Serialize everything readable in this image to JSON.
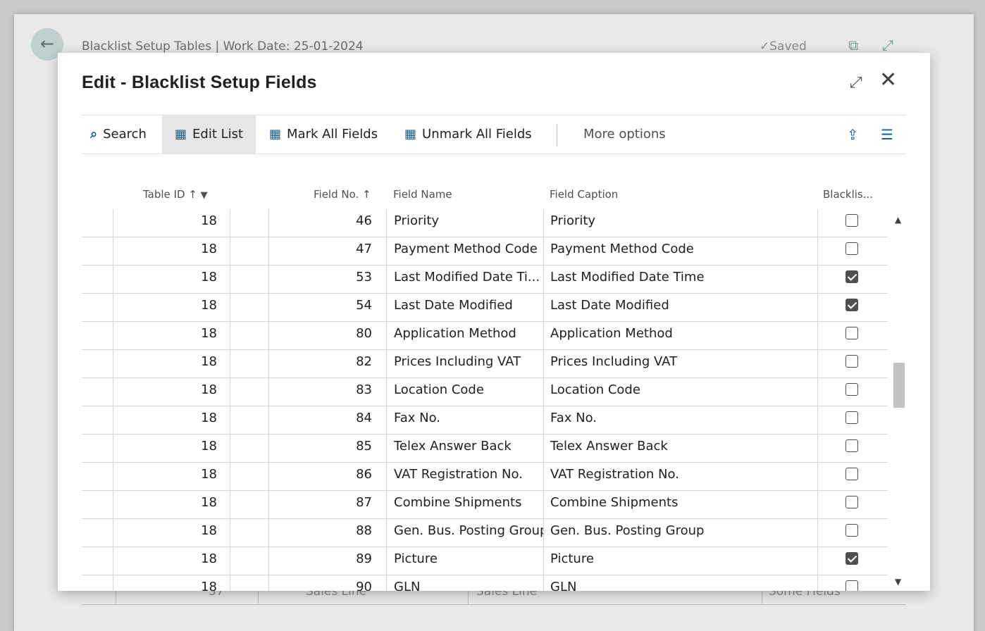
{
  "background": {
    "title": "Blacklist Setup Tables | Work Date: 25-01-2024",
    "saved": "Saved",
    "partial_row": [
      "37",
      "Sales Line",
      "Sales Line",
      "Some Fields"
    ]
  },
  "dialog": {
    "title": "Edit - Blacklist Setup Fields",
    "toolbar": {
      "search": "Search",
      "edit_list": "Edit List",
      "mark_all": "Mark All Fields",
      "unmark_all": "Unmark All Fields",
      "more": "More options"
    },
    "columns": {
      "table_id": "Table ID ↑",
      "field_no": "Field No. ↑",
      "field_name": "Field Name",
      "field_caption": "Field Caption",
      "blacklisted": "Blacklis..."
    },
    "rows": [
      {
        "table_id": "18",
        "field_no": "46",
        "field_name": "Priority",
        "field_caption": "Priority",
        "blacklisted": false
      },
      {
        "table_id": "18",
        "field_no": "47",
        "field_name": "Payment Method Code",
        "field_caption": "Payment Method Code",
        "blacklisted": false
      },
      {
        "table_id": "18",
        "field_no": "53",
        "field_name": "Last Modified Date Ti...",
        "field_caption": "Last Modified Date Time",
        "blacklisted": true
      },
      {
        "table_id": "18",
        "field_no": "54",
        "field_name": "Last Date Modified",
        "field_caption": "Last Date Modified",
        "blacklisted": true
      },
      {
        "table_id": "18",
        "field_no": "80",
        "field_name": "Application Method",
        "field_caption": "Application Method",
        "blacklisted": false
      },
      {
        "table_id": "18",
        "field_no": "82",
        "field_name": "Prices Including VAT",
        "field_caption": "Prices Including VAT",
        "blacklisted": false
      },
      {
        "table_id": "18",
        "field_no": "83",
        "field_name": "Location Code",
        "field_caption": "Location Code",
        "blacklisted": false
      },
      {
        "table_id": "18",
        "field_no": "84",
        "field_name": "Fax No.",
        "field_caption": "Fax No.",
        "blacklisted": false
      },
      {
        "table_id": "18",
        "field_no": "85",
        "field_name": "Telex Answer Back",
        "field_caption": "Telex Answer Back",
        "blacklisted": false
      },
      {
        "table_id": "18",
        "field_no": "86",
        "field_name": "VAT Registration No.",
        "field_caption": "VAT Registration No.",
        "blacklisted": false
      },
      {
        "table_id": "18",
        "field_no": "87",
        "field_name": "Combine Shipments",
        "field_caption": "Combine Shipments",
        "blacklisted": false
      },
      {
        "table_id": "18",
        "field_no": "88",
        "field_name": "Gen. Bus. Posting Group",
        "field_caption": "Gen. Bus. Posting Group",
        "blacklisted": false
      },
      {
        "table_id": "18",
        "field_no": "89",
        "field_name": "Picture",
        "field_caption": "Picture",
        "blacklisted": true
      },
      {
        "table_id": "18",
        "field_no": "90",
        "field_name": "GLN",
        "field_caption": "GLN",
        "blacklisted": false
      }
    ]
  },
  "icons": {
    "back": "arrow-left-icon",
    "saved": "check-icon",
    "open_new": "open-in-new-window-icon",
    "expand": "expand-icon",
    "close": "close-icon",
    "search": "search-icon",
    "edit_list": "edit-list-icon",
    "mark_all": "mark-all-icon",
    "unmark_all": "unmark-all-icon",
    "share": "share-icon",
    "list_view": "list-view-icon",
    "filter": "filter-icon"
  }
}
